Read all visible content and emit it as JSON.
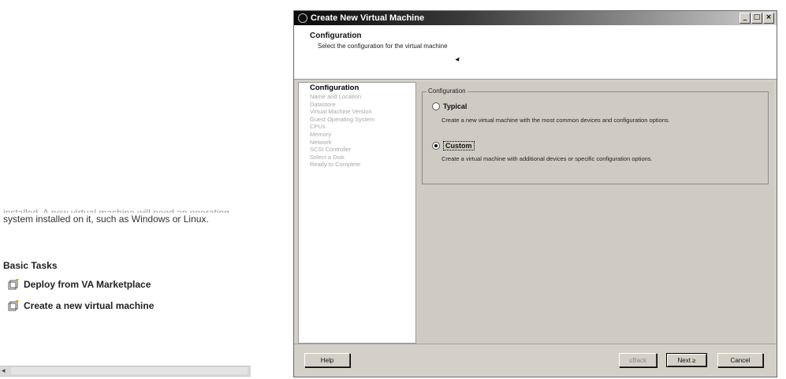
{
  "background_panel": {
    "cut_text": "installed. A new virtual machine will need an operating",
    "description": "system installed on it, such as Windows or Linux.",
    "basic_tasks_heading": "Basic Tasks",
    "tasks": [
      {
        "label": "Deploy from VA Marketplace",
        "icon": "deploy-icon"
      },
      {
        "label": "Create a new virtual machine",
        "icon": "new-vm-icon"
      }
    ]
  },
  "wizard": {
    "title": "Create New Virtual Machine",
    "window_buttons": {
      "minimize": "_",
      "maximize": "□",
      "close": "×"
    },
    "header": {
      "title": "Configuration",
      "subtitle": "Select the configuration for the virtual machine"
    },
    "steps": [
      "Configuration",
      "Name and Location",
      "Datastore",
      "Virtual Machine Version",
      "Guest Operating System",
      "CPUs",
      "Memory",
      "Network",
      "SCSI Controller",
      "Select a Disk",
      "Ready to Complete"
    ],
    "active_step": "Configuration",
    "config_group": {
      "legend": "Configuration",
      "options": [
        {
          "label": "Typical",
          "description": "Create a new virtual machine with the most common devices and configuration options.",
          "selected": false
        },
        {
          "label": "Custom",
          "description": "Create a virtual machine with additional devices or specific configuration options.",
          "selected": true
        }
      ]
    },
    "buttons": {
      "help": "Help",
      "back": "≤Back",
      "next": "Next ≥",
      "cancel": "Cancel"
    }
  },
  "colors": {
    "window_face": "#d4d0c8",
    "content_bg": "#cfcbc3",
    "titlebar_start": "#0a0a0a",
    "titlebar_end": "#d0d0d0"
  }
}
